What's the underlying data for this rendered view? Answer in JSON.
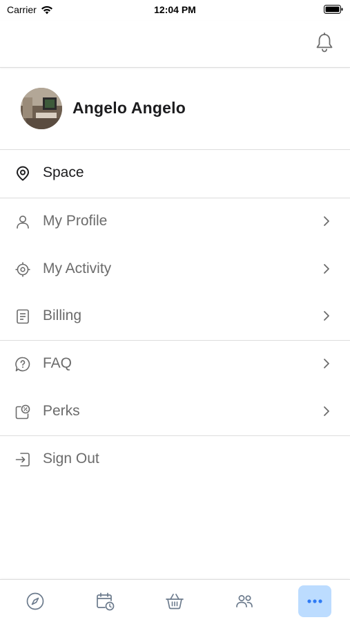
{
  "status_bar": {
    "carrier": "Carrier",
    "time": "12:04 PM"
  },
  "header": {
    "icons": [
      "bell-icon"
    ]
  },
  "profile": {
    "name": "Angelo Angelo"
  },
  "menu": {
    "space": {
      "label": "Space",
      "icon": "location-pin-icon"
    },
    "my_profile": {
      "label": "My Profile",
      "icon": "user-icon"
    },
    "my_activity": {
      "label": "My Activity",
      "icon": "target-icon"
    },
    "billing": {
      "label": "Billing",
      "icon": "document-icon"
    },
    "faq": {
      "label": "FAQ",
      "icon": "question-bubble-icon"
    },
    "perks": {
      "label": "Perks",
      "icon": "discount-tag-icon"
    },
    "sign_out": {
      "label": "Sign Out",
      "icon": "sign-out-icon"
    }
  },
  "tab_bar": {
    "tabs": [
      {
        "icon": "compass-icon",
        "active": false
      },
      {
        "icon": "calendar-clock-icon",
        "active": false
      },
      {
        "icon": "basket-icon",
        "active": false
      },
      {
        "icon": "people-icon",
        "active": false
      },
      {
        "icon": "more-dots-icon",
        "active": true
      }
    ]
  },
  "colors": {
    "accent": "#2f7bf5",
    "active_tab_bg": "#bcdcff",
    "label_gray": "#6b6b6b",
    "divider": "#dcdcdc"
  }
}
